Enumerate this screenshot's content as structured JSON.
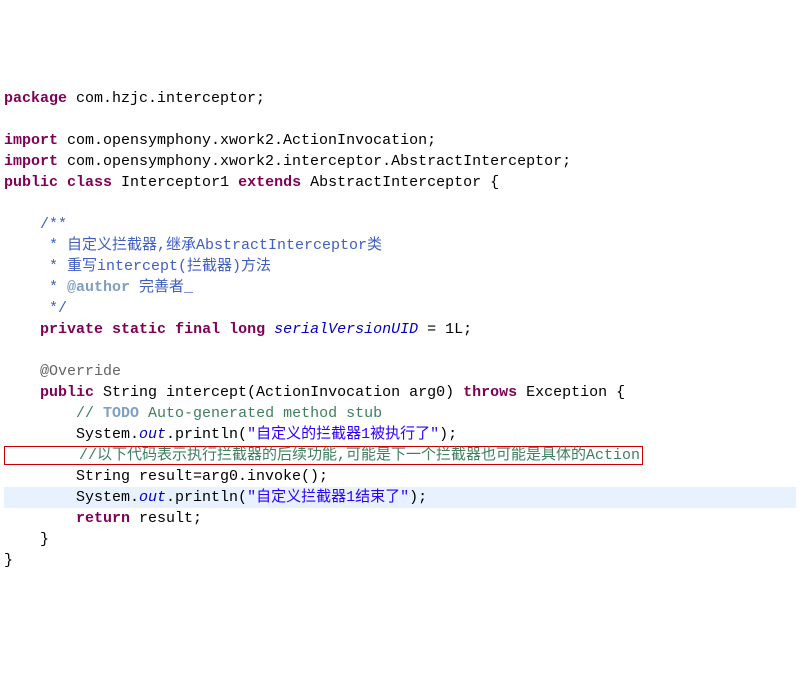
{
  "code": {
    "l1": {
      "kw1": "package",
      "rest": " com.hzjc.interceptor;"
    },
    "l3": {
      "kw1": "import",
      "rest": " com.opensymphony.xwork2.ActionInvocation;"
    },
    "l4": {
      "kw1": "import",
      "rest": " com.opensymphony.xwork2.interceptor.AbstractInterceptor;"
    },
    "l5": {
      "kw1": "public",
      "kw2": "class",
      "name": " Interceptor1 ",
      "kw3": "extends",
      "rest": " AbstractInterceptor {"
    },
    "l7": "    /**",
    "l8": "     * 自定义拦截器,继承AbstractInterceptor类",
    "l9": "     * 重写intercept(拦截器)方法",
    "l10a": "     * ",
    "l10tag": "@author",
    "l10b": " 完善者_",
    "l11": "     */",
    "l12": {
      "kw1": "private",
      "kw2": "static",
      "kw3": "final",
      "kw4": "long",
      "field": "serialVersionUID",
      "rest": " = 1L;"
    },
    "l14": "    @Override",
    "l15": {
      "kw1": "public",
      "rest1": " String intercept(ActionInvocation arg0) ",
      "kw2": "throws",
      "rest2": " Exception {"
    },
    "l16": {
      "c1": "        // ",
      "todo": "TODO",
      "c2": " Auto-generated method stub"
    },
    "l17": {
      "p1": "        System.",
      "out": "out",
      "p2": ".println(",
      "str": "\"自定义的拦截器1被执行了\"",
      "p3": ");"
    },
    "l18": "        //以下代码表示执行拦截器的后续功能,可能是下一个拦截器也可能是具体的Action",
    "l19": "        String result=arg0.invoke();",
    "l20": {
      "p1": "        System.",
      "out": "out",
      "p2": ".println(",
      "str": "\"自定义拦截器1结束了\"",
      "p3": ");"
    },
    "l21": {
      "kw1": "return",
      "rest": " result;"
    },
    "l22": "    }",
    "l23": "}"
  }
}
